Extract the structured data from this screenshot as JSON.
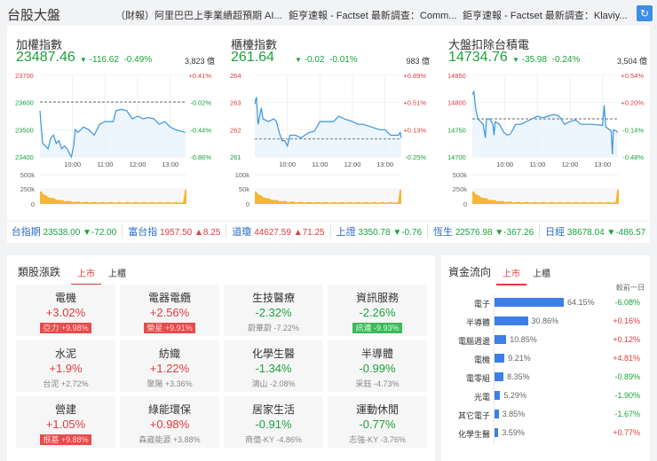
{
  "header": {
    "title": "台股大盤",
    "news": [
      "（財報）阿里巴巴上季業績超預期 AI...",
      "鉅亨速報 - Factset 最新調查：Comm...",
      "鉅亨速報 - Factset 最新調查：Klaviy..."
    ],
    "refresh_icon": "refresh-icon"
  },
  "indices": [
    {
      "name": "加權指數",
      "price": "23487.46",
      "change": "-116.62",
      "pct": "-0.49%",
      "volume": "3,823 億",
      "y_labels": [
        "23700",
        "23600",
        "23500",
        "23400"
      ],
      "pct_labels": [
        "+0.41%",
        "-0.02%",
        "-0.44%",
        "-0.86%"
      ],
      "vol_labels": [
        "500k",
        "250k",
        "0"
      ],
      "ylim": [
        23400,
        23700
      ],
      "prev_close": 23602,
      "series": [
        [
          0,
          23570
        ],
        [
          2,
          23520
        ],
        [
          5,
          23450
        ],
        [
          10,
          23440
        ],
        [
          15,
          23430
        ],
        [
          20,
          23470
        ],
        [
          25,
          23480
        ],
        [
          30,
          23450
        ],
        [
          35,
          23460
        ],
        [
          40,
          23430
        ],
        [
          45,
          23440
        ],
        [
          50,
          23430
        ],
        [
          55,
          23410
        ],
        [
          58,
          23400
        ],
        [
          62,
          23440
        ],
        [
          65,
          23500
        ],
        [
          70,
          23490
        ],
        [
          80,
          23510
        ],
        [
          90,
          23500
        ],
        [
          100,
          23480
        ],
        [
          110,
          23520
        ],
        [
          120,
          23530
        ],
        [
          135,
          23530
        ],
        [
          140,
          23570
        ],
        [
          150,
          23575
        ],
        [
          160,
          23570
        ],
        [
          170,
          23540
        ],
        [
          180,
          23550
        ],
        [
          190,
          23540
        ],
        [
          200,
          23545
        ],
        [
          210,
          23540
        ],
        [
          220,
          23520
        ],
        [
          230,
          23530
        ],
        [
          240,
          23510
        ],
        [
          250,
          23500
        ],
        [
          260,
          23495
        ],
        [
          268,
          23490
        ]
      ]
    },
    {
      "name": "櫃檯指數",
      "price": "261.64",
      "change": "-0.02",
      "pct": "-0.01%",
      "volume": "983 億",
      "y_labels": [
        "264",
        "263",
        "262",
        "261"
      ],
      "pct_labels": [
        "+0.89%",
        "+0.51%",
        "+0.13%",
        "-0.25%"
      ],
      "vol_labels": [
        "100k",
        "50k",
        "0"
      ],
      "ylim": [
        261,
        264
      ],
      "prev_close": 261.66,
      "series": [
        [
          0,
          262.95
        ],
        [
          3,
          263.2
        ],
        [
          6,
          262.2
        ],
        [
          12,
          262.8
        ],
        [
          15,
          262.4
        ],
        [
          25,
          262.3
        ],
        [
          35,
          262.4
        ],
        [
          40,
          262.3
        ],
        [
          45,
          261.9
        ],
        [
          50,
          261.6
        ],
        [
          55,
          261.6
        ],
        [
          60,
          261.4
        ],
        [
          65,
          261.8
        ],
        [
          75,
          261.8
        ],
        [
          85,
          261.7
        ],
        [
          100,
          261.9
        ],
        [
          110,
          261.95
        ],
        [
          120,
          262.3
        ],
        [
          135,
          262.3
        ],
        [
          145,
          262.3
        ],
        [
          155,
          262.5
        ],
        [
          165,
          262.4
        ],
        [
          180,
          262.3
        ],
        [
          190,
          262.2
        ],
        [
          200,
          262.2
        ],
        [
          215,
          262.1
        ],
        [
          230,
          262.0
        ],
        [
          240,
          262.0
        ],
        [
          250,
          261.8
        ],
        [
          265,
          261.8
        ],
        [
          268,
          261.9
        ],
        [
          270,
          261.7
        ]
      ]
    },
    {
      "name": "大盤扣除台積電",
      "price": "14734.76",
      "change": "-35.98",
      "pct": "-0.24%",
      "volume": "3,504 億",
      "y_labels": [
        "14850",
        "14800",
        "14750",
        "14700"
      ],
      "pct_labels": [
        "+0.54%",
        "+0.20%",
        "-0.14%",
        "-0.48%"
      ],
      "vol_labels": [
        "500k",
        "250k",
        "0"
      ],
      "ylim": [
        14700,
        14850
      ],
      "prev_close": 14770,
      "series": [
        [
          0,
          14815
        ],
        [
          3,
          14820
        ],
        [
          6,
          14790
        ],
        [
          10,
          14770
        ],
        [
          15,
          14765
        ],
        [
          20,
          14760
        ],
        [
          24,
          14735
        ],
        [
          26,
          14770
        ],
        [
          32,
          14770
        ],
        [
          38,
          14760
        ],
        [
          40,
          14740
        ],
        [
          42,
          14765
        ],
        [
          50,
          14760
        ],
        [
          58,
          14745
        ],
        [
          65,
          14740
        ],
        [
          70,
          14742
        ],
        [
          80,
          14760
        ],
        [
          90,
          14760
        ],
        [
          100,
          14765
        ],
        [
          110,
          14770
        ],
        [
          120,
          14775
        ],
        [
          130,
          14772
        ],
        [
          140,
          14775
        ],
        [
          150,
          14778
        ],
        [
          160,
          14775
        ],
        [
          170,
          14760
        ],
        [
          180,
          14765
        ],
        [
          190,
          14768
        ],
        [
          200,
          14760
        ],
        [
          220,
          14760
        ],
        [
          240,
          14758
        ],
        [
          243,
          14795
        ],
        [
          246,
          14755
        ],
        [
          256,
          14748
        ],
        [
          258,
          14705
        ],
        [
          260,
          14750
        ],
        [
          265,
          14748
        ],
        [
          268,
          14745
        ]
      ]
    }
  ],
  "time_labels": [
    "10:00",
    "11:00",
    "12:00",
    "13:00"
  ],
  "ticker": [
    {
      "name": "台指期",
      "value": "23538.00",
      "change": "▼-72.00",
      "dir": "dn"
    },
    {
      "name": "富台指",
      "value": "1957.50",
      "change": "▲8.25",
      "dir": "up"
    },
    {
      "name": "道瓊",
      "value": "44627.59",
      "change": "▲71.25",
      "dir": "up"
    },
    {
      "name": "上證",
      "value": "3350.78",
      "change": "▼-0.76",
      "dir": "dn"
    },
    {
      "name": "恆生",
      "value": "22576.98",
      "change": "▼-367.26",
      "dir": "dn"
    },
    {
      "name": "日經",
      "value": "38678.04",
      "change": "▼-486.57",
      "dir": "dn"
    }
  ],
  "sectors": {
    "title": "類股漲跌",
    "tabs": [
      "上市",
      "上櫃"
    ],
    "items": [
      {
        "name": "電機",
        "pct": "+3.02%",
        "stock": "亞力  +9.98%",
        "dir": "up",
        "hl": true
      },
      {
        "name": "電器電纜",
        "pct": "+2.56%",
        "stock": "榮星  +9.91%",
        "dir": "up",
        "hl": true
      },
      {
        "name": "生技醫療",
        "pct": "-2.32%",
        "stock": "蔚華蔚  -7.22%",
        "dir": "dn",
        "hl": false
      },
      {
        "name": "資訊服務",
        "pct": "-2.26%",
        "stock": "訊連  -9.93%",
        "dir": "dn",
        "hl": true
      },
      {
        "name": "水泥",
        "pct": "+1.9%",
        "stock": "台泥  +2.72%",
        "dir": "up",
        "hl": false
      },
      {
        "name": "紡織",
        "pct": "+1.22%",
        "stock": "聚陽  +3.36%",
        "dir": "up",
        "hl": false
      },
      {
        "name": "化學生醫",
        "pct": "-1.34%",
        "stock": "鴻山  -2.08%",
        "dir": "dn",
        "hl": false
      },
      {
        "name": "半導體",
        "pct": "-0.99%",
        "stock": "采鈺  -4.73%",
        "dir": "dn",
        "hl": false
      },
      {
        "name": "營建",
        "pct": "+1.05%",
        "stock": "根基  +9.88%",
        "dir": "up",
        "hl": true
      },
      {
        "name": "綠能環保",
        "pct": "+0.98%",
        "stock": "森崴能源  +3.88%",
        "dir": "up",
        "hl": false
      },
      {
        "name": "居家生活",
        "pct": "-0.91%",
        "stock": "商億-KY  -4.86%",
        "dir": "dn",
        "hl": false
      },
      {
        "name": "運動休閒",
        "pct": "-0.77%",
        "stock": "志強-KY  -3.76%",
        "dir": "dn",
        "hl": false
      }
    ]
  },
  "flow": {
    "title": "資金流向",
    "tabs": [
      "上市",
      "上櫃"
    ],
    "col_header": "較前一日",
    "items": [
      {
        "name": "電子",
        "share": 64.15,
        "share_label": "64.15%",
        "diff": "-6.08%",
        "dir": "dn"
      },
      {
        "name": "半導體",
        "share": 30.86,
        "share_label": "30.86%",
        "diff": "+0.16%",
        "dir": "up"
      },
      {
        "name": "電腦週邊",
        "share": 10.85,
        "share_label": "10.85%",
        "diff": "+0.12%",
        "dir": "up"
      },
      {
        "name": "電機",
        "share": 9.21,
        "share_label": "9.21%",
        "diff": "+4.81%",
        "dir": "up"
      },
      {
        "name": "電零組",
        "share": 8.35,
        "share_label": "8.35%",
        "diff": "-0.89%",
        "dir": "dn"
      },
      {
        "name": "光電",
        "share": 5.29,
        "share_label": "5.29%",
        "diff": "-1.90%",
        "dir": "dn"
      },
      {
        "name": "其它電子",
        "share": 3.85,
        "share_label": "3.85%",
        "diff": "-1.67%",
        "dir": "dn"
      },
      {
        "name": "化學生醫",
        "share": 3.59,
        "share_label": "3.59%",
        "diff": "+0.77%",
        "dir": "up"
      }
    ]
  },
  "colors": {
    "up": "#e03c3c",
    "down": "#1aa33a",
    "line": "#3a95e0",
    "accent": "#3a8ee6",
    "volume": "#f5b731"
  }
}
